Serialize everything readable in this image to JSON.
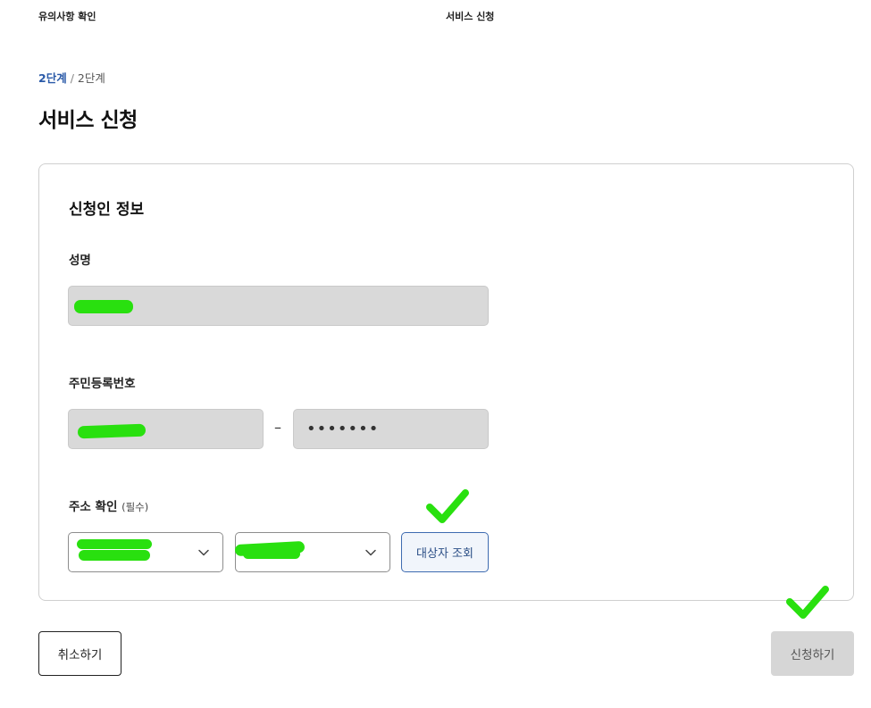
{
  "steps": {
    "step1": "유의사항 확인",
    "step2": "서비스 신청"
  },
  "breadcrumb": {
    "current": "2단계",
    "separator": "/",
    "total": "2단계"
  },
  "page_title": "서비스 신청",
  "applicant": {
    "section_title": "신청인 정보",
    "name_label": "성명",
    "rrn_label": "주민등록번호",
    "rrn_separator": "–",
    "rrn_back_masked": "•••••••",
    "address_label": "주소 확인",
    "address_required": "(필수)",
    "lookup_button": "대상자 조회"
  },
  "actions": {
    "cancel": "취소하기",
    "submit": "신청하기"
  },
  "colors": {
    "accent": "#2a5aa8",
    "redaction": "#29e00f",
    "disabled": "#d6d6d6"
  }
}
